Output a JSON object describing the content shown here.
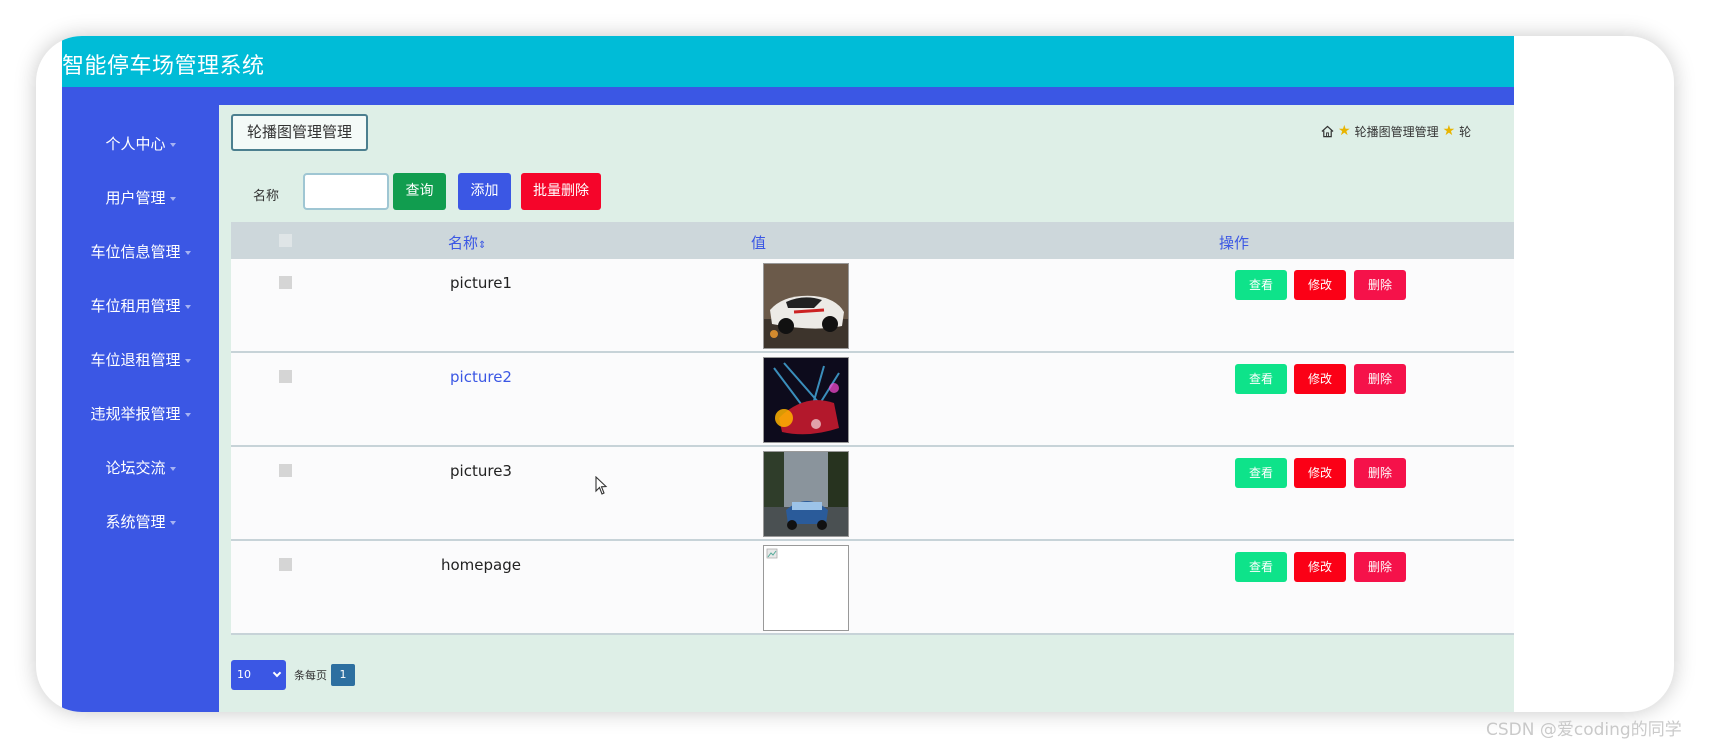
{
  "app": {
    "title": "智能停车场管理系统"
  },
  "sidebar": {
    "items": [
      {
        "label": "个人中心"
      },
      {
        "label": "用户管理"
      },
      {
        "label": "车位信息管理"
      },
      {
        "label": "车位租用管理"
      },
      {
        "label": "车位退租管理"
      },
      {
        "label": "违规举报管理"
      },
      {
        "label": "论坛交流"
      },
      {
        "label": "系统管理"
      }
    ]
  },
  "page": {
    "tab_label": "轮播图管理管理",
    "breadcrumb": {
      "item": "轮播图管理管理",
      "trailing": "轮"
    }
  },
  "search": {
    "label": "名称",
    "value": "",
    "query_label": "查询",
    "add_label": "添加",
    "batch_delete_label": "批量删除"
  },
  "table": {
    "headers": {
      "name": "名称",
      "value": "值",
      "actions": "操作"
    },
    "sort_icon": "sort-icon",
    "rows": [
      {
        "name": "picture1",
        "image": "car-white-race",
        "view": "查看",
        "edit": "修改",
        "del": "删除"
      },
      {
        "name": "picture2",
        "image": "car-red-lights",
        "view": "查看",
        "edit": "修改",
        "del": "删除"
      },
      {
        "name": "picture3",
        "image": "car-blue-road",
        "view": "查看",
        "edit": "修改",
        "del": "删除"
      },
      {
        "name": "homepage",
        "image": "broken-image",
        "view": "查看",
        "edit": "修改",
        "del": "删除"
      }
    ]
  },
  "pager": {
    "page_size": "10",
    "per_page_label": "条每页",
    "current_page": "1"
  },
  "watermark": "CSDN @爱coding的同学",
  "colors": {
    "topbar": "#00bcd7",
    "sidebar": "#3b57e4",
    "content_bg": "#deefe7",
    "query": "#119d4f",
    "add": "#3b57e4",
    "danger": "#f5052a",
    "view": "#0ee38a"
  }
}
